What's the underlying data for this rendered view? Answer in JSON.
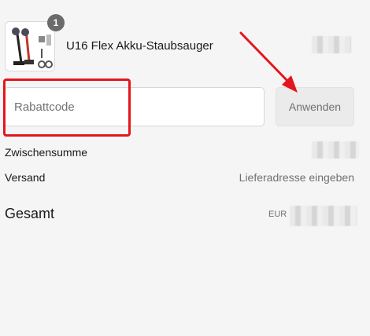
{
  "product": {
    "name": "U16 Flex Akku-Staubsauger",
    "quantity": "1"
  },
  "discount": {
    "placeholder": "Rabattcode",
    "apply_label": "Anwenden"
  },
  "summary": {
    "subtotal_label": "Zwischensumme",
    "shipping_label": "Versand",
    "shipping_value": "Lieferadresse eingeben",
    "total_label": "Gesamt",
    "currency_prefix": "EUR"
  },
  "colors": {
    "annotation": "#e5151d",
    "background": "#f5f5f5"
  }
}
